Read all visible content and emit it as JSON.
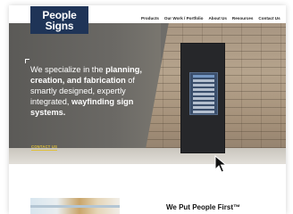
{
  "logo": {
    "line1": "People",
    "line2": "Signs"
  },
  "nav": {
    "items": [
      "Products",
      "Our Work / Portfolio",
      "About Us",
      "Resources",
      "Contact Us"
    ],
    "search_icon": "search-icon"
  },
  "hero": {
    "text_plain_1": "We specialize in the ",
    "text_bold_1": "planning, creation, and fabrication",
    "text_plain_2": " of smartly designed, expertly integrated, ",
    "text_bold_2": "wayfinding sign systems.",
    "cta_label": "CONTACT US"
  },
  "section": {
    "title": "We Put People First™"
  },
  "colors": {
    "brand_navy": "#1f3457",
    "cta_gold": "#e0c03a"
  }
}
